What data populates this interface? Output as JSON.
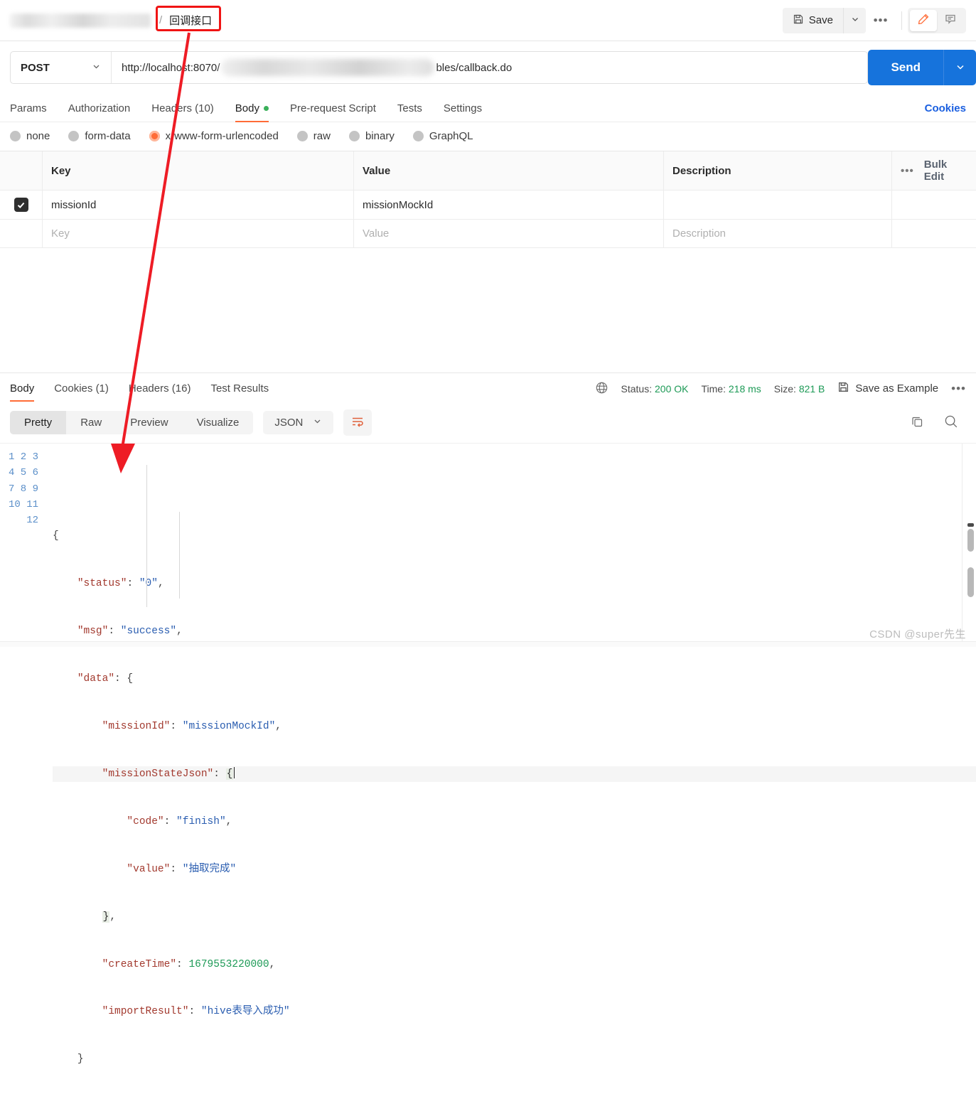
{
  "breadcrumb": {
    "workspace_masked": "",
    "separator": "/",
    "request_name": "回调接口"
  },
  "toolbar": {
    "save_label": "Save",
    "save_caret_icon": "chevron-down-icon",
    "more_label": "•••",
    "edit_icon": "pencil-icon",
    "comment_icon": "comment-icon"
  },
  "url_bar": {
    "method": "POST",
    "method_caret_icon": "chevron-down-icon",
    "url_prefix": "http://localhost:8070/",
    "url_suffix": "bles/callback.do",
    "send_label": "Send",
    "send_caret_icon": "chevron-down-icon"
  },
  "request_tabs": {
    "items": [
      {
        "label": "Params",
        "active": false
      },
      {
        "label": "Authorization",
        "active": false
      },
      {
        "label": "Headers (10)",
        "active": false
      },
      {
        "label": "Body",
        "active": true,
        "dot": true
      },
      {
        "label": "Pre-request Script",
        "active": false
      },
      {
        "label": "Tests",
        "active": false
      },
      {
        "label": "Settings",
        "active": false
      }
    ],
    "cookies_link": "Cookies"
  },
  "body_types": [
    {
      "label": "none",
      "selected": false
    },
    {
      "label": "form-data",
      "selected": false
    },
    {
      "label": "x-www-form-urlencoded",
      "selected": true
    },
    {
      "label": "raw",
      "selected": false
    },
    {
      "label": "binary",
      "selected": false
    },
    {
      "label": "GraphQL",
      "selected": false
    }
  ],
  "kv_table": {
    "headers": {
      "key": "Key",
      "value": "Value",
      "description": "Description"
    },
    "bulk": {
      "dots": "•••",
      "label": "Bulk Edit"
    },
    "rows": [
      {
        "checked": true,
        "key": "missionId",
        "value": "missionMockId",
        "description": ""
      }
    ],
    "placeholder_row": {
      "key": "Key",
      "value": "Value",
      "description": "Description"
    }
  },
  "response": {
    "tabs": [
      {
        "label": "Body",
        "active": true
      },
      {
        "label": "Cookies (1)",
        "active": false
      },
      {
        "label": "Headers (16)",
        "active": false
      },
      {
        "label": "Test Results",
        "active": false
      }
    ],
    "globe_icon": "globe-icon",
    "status_label": "Status:",
    "status_value": "200 OK",
    "time_label": "Time:",
    "time_value": "218 ms",
    "size_label": "Size:",
    "size_value": "821 B",
    "save_example_icon": "floppy-icon",
    "save_example_label": "Save as Example",
    "more_label": "•••",
    "view_modes": [
      {
        "label": "Pretty",
        "active": true
      },
      {
        "label": "Raw",
        "active": false
      },
      {
        "label": "Preview",
        "active": false
      },
      {
        "label": "Visualize",
        "active": false
      }
    ],
    "format": "JSON",
    "format_caret_icon": "chevron-down-icon",
    "wrap_icon": "wrap-lines-icon",
    "copy_icon": "copy-icon",
    "search_icon": "search-icon",
    "line_numbers": [
      "1",
      "2",
      "3",
      "4",
      "5",
      "6",
      "7",
      "8",
      "9",
      "10",
      "11",
      "12"
    ]
  },
  "response_body": {
    "status": "0",
    "msg": "success",
    "data": {
      "missionId": "missionMockId",
      "missionStateJson": {
        "code": "finish",
        "value": "抽取完成"
      },
      "createTime": "1679553220000",
      "importResult": "hive表导入成功"
    }
  },
  "code_lines": [
    {
      "n": 1,
      "text": "{"
    },
    {
      "n": 2,
      "text": "    \"status\": \"0\","
    },
    {
      "n": 3,
      "text": "    \"msg\": \"success\","
    },
    {
      "n": 4,
      "text": "    \"data\": {"
    },
    {
      "n": 5,
      "text": "        \"missionId\": \"missionMockId\","
    },
    {
      "n": 6,
      "text": "        \"missionStateJson\": {"
    },
    {
      "n": 7,
      "text": "            \"code\": \"finish\","
    },
    {
      "n": 8,
      "text": "            \"value\": \"抽取完成\""
    },
    {
      "n": 9,
      "text": "        },"
    },
    {
      "n": 10,
      "text": "        \"createTime\": 1679553220000,"
    },
    {
      "n": 11,
      "text": "        \"importResult\": \"hive表导入成功\""
    },
    {
      "n": 12,
      "text": "    }"
    }
  ],
  "annotation": {
    "highlight_target": "回调接口",
    "arrow_color": "#ee1c25"
  },
  "watermark": "CSDN @super先生",
  "colors": {
    "accent": "#ff6c37",
    "send_blue": "#1673dc",
    "link_blue": "#1a5fe0",
    "status_green": "#1d9a56",
    "annotation_red": "#ee1c25"
  }
}
